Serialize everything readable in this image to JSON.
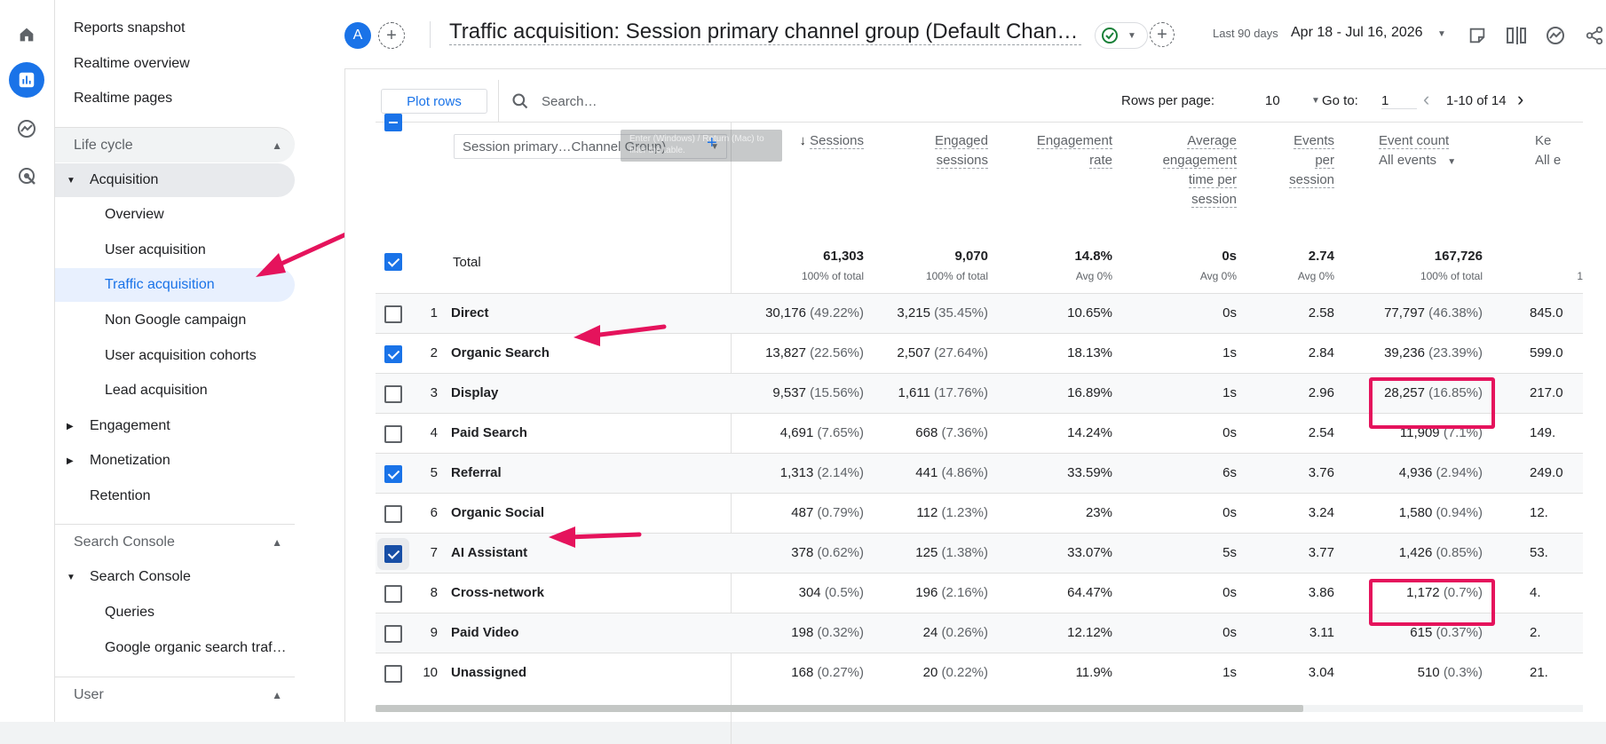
{
  "rail": {
    "items": [
      {
        "icon": "home-icon"
      },
      {
        "icon": "reports-icon",
        "active": true
      },
      {
        "icon": "explore-icon"
      },
      {
        "icon": "advertising-icon"
      }
    ]
  },
  "sidebar": {
    "top_items": [
      "Reports snapshot",
      "Realtime overview",
      "Realtime pages"
    ],
    "lifecycle": {
      "section": "Life cycle",
      "acquisition": "Acquisition",
      "acquisition_items": [
        "Overview",
        "User acquisition",
        "Traffic acquisition",
        "Non Google campaign",
        "User acquisition cohorts",
        "Lead acquisition"
      ],
      "engagement": "Engagement",
      "monetization": "Monetization",
      "retention": "Retention"
    },
    "search_console": {
      "section": "Search Console",
      "group": "Search Console",
      "items": [
        "Queries",
        "Google organic search traf…"
      ]
    },
    "user_section": "User"
  },
  "topbar": {
    "avatar_letter": "A",
    "title": "Traffic acquisition: Session primary channel group (Default Chan…",
    "date_label": "Last 90 days",
    "date_range": "Apr 18 - Jul 16, 2026"
  },
  "toolbar": {
    "plot_rows": "Plot rows",
    "search_placeholder": "Search…",
    "rows_per_page_label": "Rows per page:",
    "rows_per_page": "10",
    "goto_label": "Go to:",
    "goto_value": "1",
    "page_range": "1-10 of 14"
  },
  "table": {
    "dimension": "Session primary…Channel Group)",
    "tooltip_ghost": "Enter (Windows) / Return (Mac) to filter the table.",
    "headers": {
      "sessions": "Sessions",
      "engaged_sessions": [
        "Engaged",
        "sessions"
      ],
      "engagement_rate": [
        "Engagement",
        "rate"
      ],
      "avg_engagement_time": [
        "Average",
        "engagement",
        "time per",
        "session"
      ],
      "events_per_session": [
        "Events",
        "per",
        "session"
      ],
      "event_count": "Event count",
      "event_count_sub": "All events",
      "key_events": "Ke",
      "key_events_sub": "All e"
    },
    "total": {
      "label": "Total",
      "sessions": "61,303",
      "sessions_sub": "100% of total",
      "engaged": "9,070",
      "engaged_sub": "100% of total",
      "rate": "14.8%",
      "rate_sub": "Avg 0%",
      "time": "0s",
      "time_sub": "Avg 0%",
      "eps": "2.74",
      "eps_sub": "Avg 0%",
      "events": "167,726",
      "events_sub": "100% of total",
      "key_sub": "1"
    },
    "rows": [
      {
        "n": "1",
        "name": "Direct",
        "sessions": "30,176",
        "sessions_pct": "(49.22%)",
        "engaged": "3,215",
        "engaged_pct": "(35.45%)",
        "rate": "10.65%",
        "time": "0s",
        "eps": "2.58",
        "events": "77,797",
        "events_pct": "(46.38%)",
        "key": "845.0",
        "checked": false
      },
      {
        "n": "2",
        "name": "Organic Search",
        "sessions": "13,827",
        "sessions_pct": "(22.56%)",
        "engaged": "2,507",
        "engaged_pct": "(27.64%)",
        "rate": "18.13%",
        "time": "1s",
        "eps": "2.84",
        "events": "39,236",
        "events_pct": "(23.39%)",
        "key": "599.0",
        "checked": true
      },
      {
        "n": "3",
        "name": "Display",
        "sessions": "9,537",
        "sessions_pct": "(15.56%)",
        "engaged": "1,611",
        "engaged_pct": "(17.76%)",
        "rate": "16.89%",
        "time": "1s",
        "eps": "2.96",
        "events": "28,257",
        "events_pct": "(16.85%)",
        "key": "217.0",
        "checked": false
      },
      {
        "n": "4",
        "name": "Paid Search",
        "sessions": "4,691",
        "sessions_pct": "(7.65%)",
        "engaged": "668",
        "engaged_pct": "(7.36%)",
        "rate": "14.24%",
        "time": "0s",
        "eps": "2.54",
        "events": "11,909",
        "events_pct": "(7.1%)",
        "key": "149.",
        "checked": false
      },
      {
        "n": "5",
        "name": "Referral",
        "sessions": "1,313",
        "sessions_pct": "(2.14%)",
        "engaged": "441",
        "engaged_pct": "(4.86%)",
        "rate": "33.59%",
        "time": "6s",
        "eps": "3.76",
        "events": "4,936",
        "events_pct": "(2.94%)",
        "key": "249.0",
        "checked": true
      },
      {
        "n": "6",
        "name": "Organic Social",
        "sessions": "487",
        "sessions_pct": "(0.79%)",
        "engaged": "112",
        "engaged_pct": "(1.23%)",
        "rate": "23%",
        "time": "0s",
        "eps": "3.24",
        "events": "1,580",
        "events_pct": "(0.94%)",
        "key": "12.",
        "checked": false
      },
      {
        "n": "7",
        "name": "AI Assistant",
        "sessions": "378",
        "sessions_pct": "(0.62%)",
        "engaged": "125",
        "engaged_pct": "(1.38%)",
        "rate": "33.07%",
        "time": "5s",
        "eps": "3.77",
        "events": "1,426",
        "events_pct": "(0.85%)",
        "key": "53.",
        "checked": true
      },
      {
        "n": "8",
        "name": "Cross-network",
        "sessions": "304",
        "sessions_pct": "(0.5%)",
        "engaged": "196",
        "engaged_pct": "(2.16%)",
        "rate": "64.47%",
        "time": "0s",
        "eps": "3.86",
        "events": "1,172",
        "events_pct": "(0.7%)",
        "key": "4.",
        "checked": false
      },
      {
        "n": "9",
        "name": "Paid Video",
        "sessions": "198",
        "sessions_pct": "(0.32%)",
        "engaged": "24",
        "engaged_pct": "(0.26%)",
        "rate": "12.12%",
        "time": "0s",
        "eps": "3.11",
        "events": "615",
        "events_pct": "(0.37%)",
        "key": "2.",
        "checked": false
      },
      {
        "n": "10",
        "name": "Unassigned",
        "sessions": "168",
        "sessions_pct": "(0.27%)",
        "engaged": "20",
        "engaged_pct": "(0.22%)",
        "rate": "11.9%",
        "time": "1s",
        "eps": "3.04",
        "events": "510",
        "events_pct": "(0.3%)",
        "key": "21.",
        "checked": false
      }
    ]
  },
  "colors": {
    "accent": "#1a73e8",
    "annotation": "#e5135c",
    "selected_nav": "#e8f0fe"
  }
}
